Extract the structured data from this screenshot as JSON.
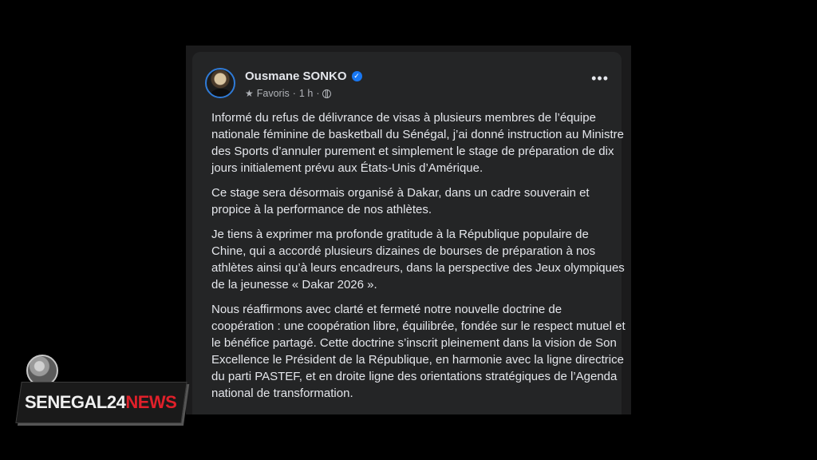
{
  "post": {
    "author": "Ousmane SONKO",
    "meta_favoris": "Favoris",
    "meta_sep1": "·",
    "meta_time": "1 h",
    "meta_sep2": "·",
    "paragraphs": [
      "Informé du refus de délivrance de visas à plusieurs membres de l’équipe nationale féminine de basketball du Sénégal, j’ai donné instruction au Ministre des Sports d’annuler purement et simplement le stage de préparation de dix jours initialement prévu aux États-Unis d’Amérique.",
      "Ce stage sera désormais organisé à Dakar, dans un cadre souverain et propice à la performance de nos athlètes.",
      "Je tiens à exprimer ma profonde gratitude à la République populaire de Chine, qui a accordé plusieurs dizaines de bourses de préparation à nos athlètes ainsi qu’à leurs encadreurs, dans la perspective des Jeux olympiques de la jeunesse « Dakar 2026 ».",
      "Nous réaffirmons avec clarté et fermeté notre nouvelle doctrine de coopération : une coopération libre, équilibrée, fondée sur le respect mutuel et le bénéfice partagé. Cette doctrine s’inscrit pleinement dans la vision de Son Excellence le Président de la République, en harmonie avec la ligne directrice du parti PASTEF, et en droite ligne des orientations stratégiques de l’Agenda national de transformation."
    ],
    "more_icon": "more-horizontal-icon",
    "verified_icon": "verified-badge-icon"
  },
  "watermark": {
    "part1": "SENEGAL24",
    "part2": "NEWS"
  },
  "colors": {
    "background": "#000000",
    "card": "#242526",
    "text": "#e4e6eb",
    "meta": "#b0b3b8",
    "verified": "#1877f2",
    "logo_red": "#e0202a"
  }
}
